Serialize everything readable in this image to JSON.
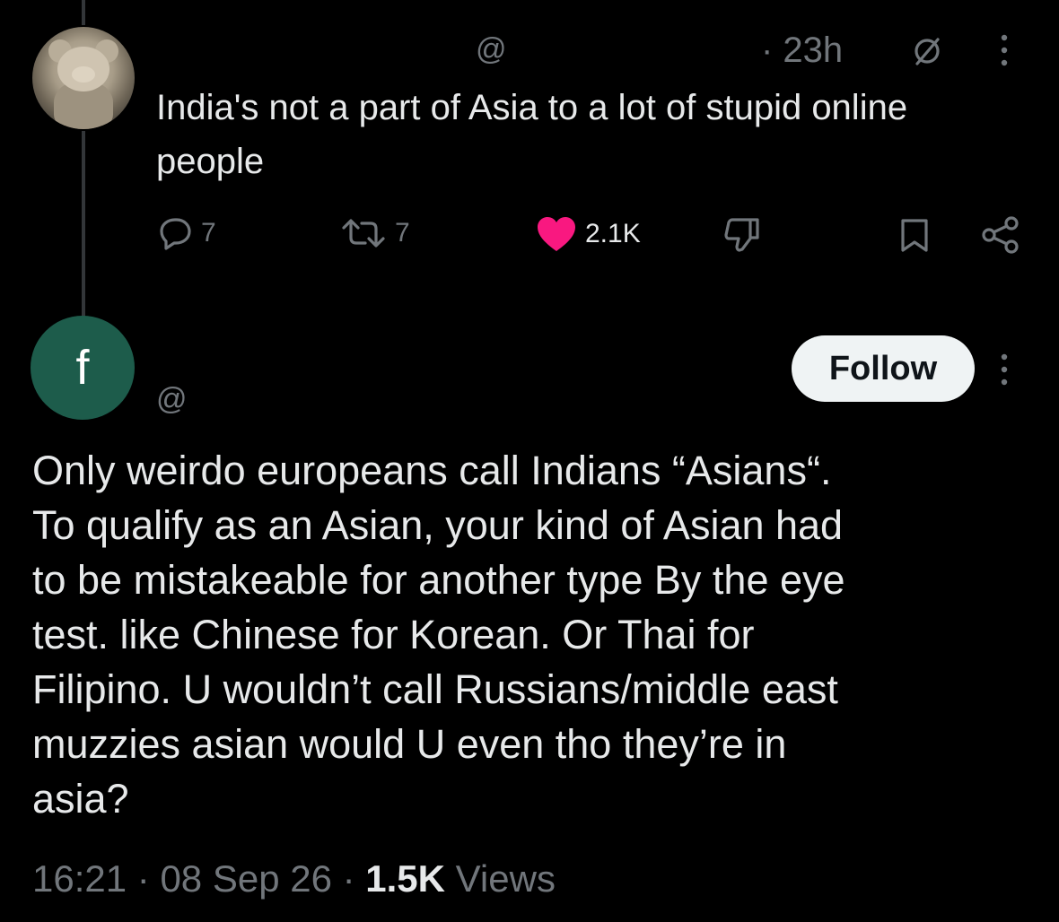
{
  "parent_post": {
    "handle": "@",
    "time": "· 23h",
    "text": "India's not a part of Asia to a lot of stupid online people",
    "replies": "7",
    "reposts": "7",
    "likes": "2.1K",
    "icons": [
      "reply-icon",
      "repost-icon",
      "heart-icon",
      "dislike-icon",
      "bookmark-icon",
      "share-icon",
      "grok-icon",
      "more-icon"
    ],
    "like_color": "#f91880"
  },
  "main_post": {
    "avatar_letter": "f",
    "avatar_color": "#1d5c4b",
    "handle": "@",
    "follow_label": "Follow",
    "text": "Only weirdo europeans call Indians “Asians“.\nTo qualify as an Asian, your kind of Asian had\nto be mistakeable for another type By the eye\ntest. like Chinese for Korean. Or Thai for\nFilipino. U wouldn’t call Russians/middle east\nmuzzies asian would U even tho they’re in\nasia?",
    "time": "16:21",
    "date": "08 Sep 26",
    "views_count": "1.5K",
    "views_label": "Views"
  }
}
